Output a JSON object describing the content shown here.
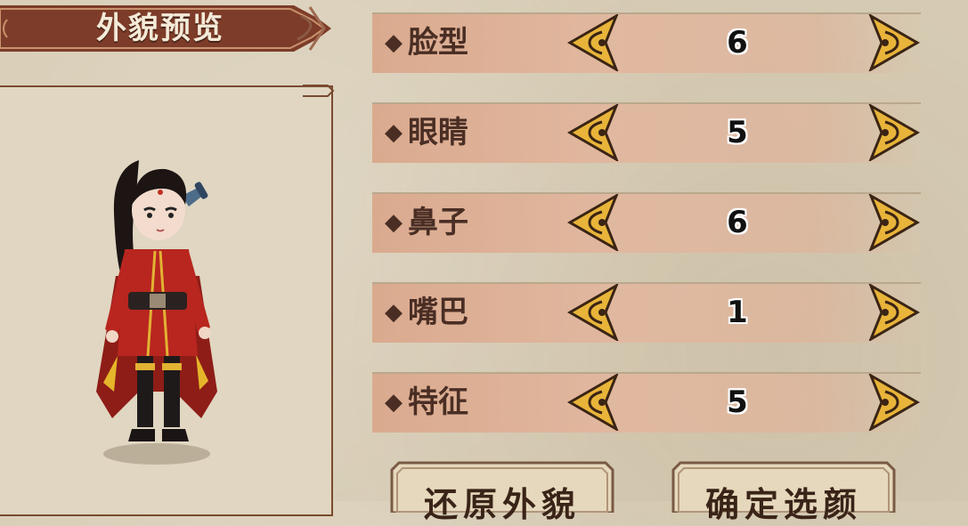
{
  "title": "外貌预览",
  "rows": [
    {
      "label": "脸型",
      "value": "6"
    },
    {
      "label": "眼睛",
      "value": "5"
    },
    {
      "label": "鼻子",
      "value": "6"
    },
    {
      "label": "嘴巴",
      "value": "1"
    },
    {
      "label": "特征",
      "value": "5"
    }
  ],
  "bullet": "◆",
  "buttons": {
    "restore": "还原外貌",
    "confirm": "确定选颜"
  },
  "icons": {
    "decrease": "ornate-left-arrow-icon",
    "increase": "ornate-right-arrow-icon"
  },
  "colors": {
    "banner": "#7a3a28",
    "row": "#dcae94",
    "arrow_gold": "#e8b43a",
    "arrow_dark": "#3a2414"
  }
}
